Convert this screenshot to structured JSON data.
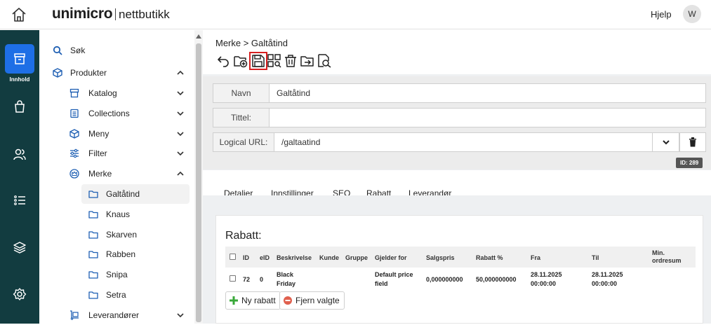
{
  "topbar": {
    "logo": "unimicro",
    "logo_sub": "nettbutikk",
    "help": "Hjelp",
    "avatar": "W"
  },
  "rail": {
    "content_label": "Innhold"
  },
  "sidebar": {
    "search": "Søk",
    "products": "Produkter",
    "catalog": "Katalog",
    "collections": "Collections",
    "menu": "Meny",
    "filter": "Filter",
    "brand": "Merke",
    "brands": [
      "Galtåtind",
      "Knaus",
      "Skarven",
      "Rabben",
      "Snipa",
      "Setra"
    ],
    "suppliers": "Leverandører"
  },
  "main": {
    "breadcrumb": "Merke > Galtåtind",
    "form": {
      "name_label": "Navn",
      "name_value": "Galtåtind",
      "title_label": "Tittel:",
      "title_value": "",
      "url_label": "Logical URL:",
      "url_value": "/galtaatind",
      "id_badge": "ID: 289"
    },
    "tabs": [
      "Detaljer",
      "Innstillinger",
      "SEO",
      "Rabatt",
      "Leverandør"
    ],
    "active_tab": "Rabatt",
    "rabatt": {
      "title": "Rabatt:",
      "columns": [
        "ID",
        "eID",
        "Beskrivelse",
        "Kunde",
        "Gruppe",
        "Gjelder for",
        "Salgspris",
        "Rabatt %",
        "Fra",
        "Til",
        "Min.",
        "ordresum"
      ],
      "row": {
        "id": "72",
        "eid": "0",
        "desc_1": "Black",
        "desc_2": "Friday",
        "applies_1": "Default price",
        "applies_2": "field",
        "price": "0,000000000",
        "discount": "50,000000000",
        "from_date": "28.11.2025",
        "from_time": "00:00:00",
        "to_date": "28.11.2025",
        "to_time": "00:00:00"
      },
      "add_button": "Ny rabatt",
      "remove_button": "Fjern valgte"
    }
  },
  "colors": {
    "rail": "#123c40",
    "active": "#1e6fe6",
    "accent": "#1d5fb3",
    "highlight": "#d61f1f"
  }
}
